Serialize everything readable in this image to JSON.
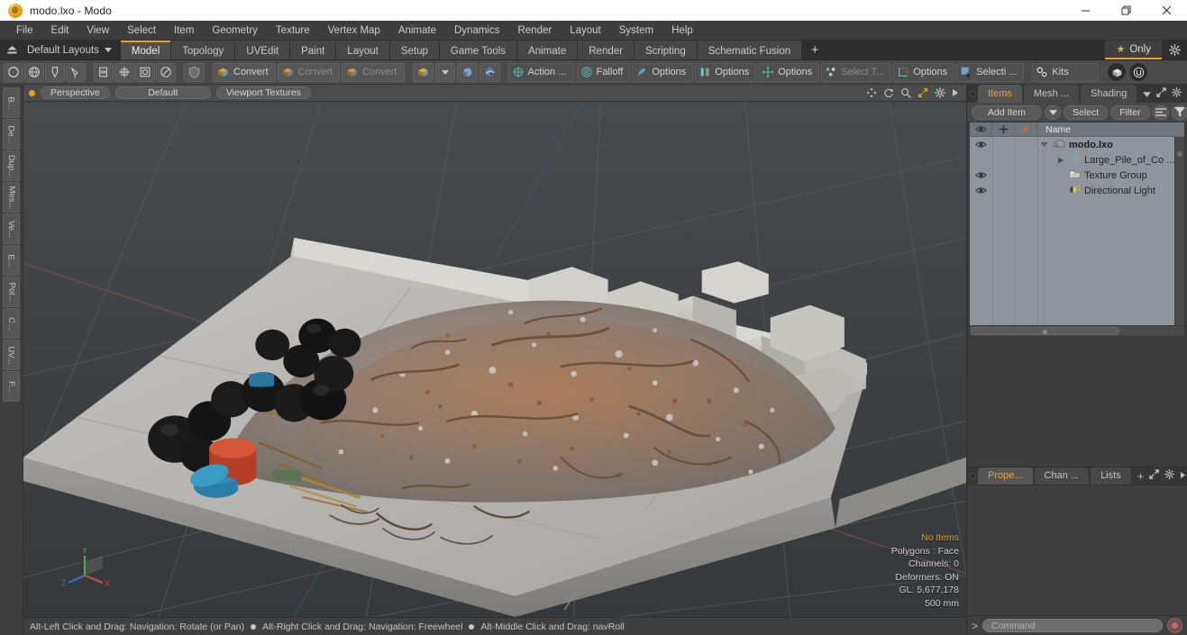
{
  "window": {
    "title": "modo.lxo - Modo",
    "app_icon": "modo-logo-icon",
    "controls": {
      "minimize": "minimize-icon",
      "maximize": "restore-icon",
      "close": "close-icon"
    }
  },
  "menubar": {
    "items": [
      "File",
      "Edit",
      "View",
      "Select",
      "Item",
      "Geometry",
      "Texture",
      "Vertex Map",
      "Animate",
      "Dynamics",
      "Render",
      "Layout",
      "System",
      "Help"
    ]
  },
  "layoutbar": {
    "home_icon": "home-eject-icon",
    "layouts_label": "Default Layouts",
    "tabs": [
      {
        "label": "Model",
        "active": true
      },
      {
        "label": "Topology",
        "active": false
      },
      {
        "label": "UVEdit",
        "active": false
      },
      {
        "label": "Paint",
        "active": false
      },
      {
        "label": "Layout",
        "active": false
      },
      {
        "label": "Setup",
        "active": false
      },
      {
        "label": "Game Tools",
        "active": false
      },
      {
        "label": "Animate",
        "active": false
      },
      {
        "label": "Render",
        "active": false
      },
      {
        "label": "Scripting",
        "active": false
      },
      {
        "label": "Schematic Fusion",
        "active": false
      }
    ],
    "add_tab_label": "+",
    "only_label": "Only",
    "only_star_icon": "star-icon",
    "gear_icon": "gear-icon",
    "accent_color": "#e0a32e"
  },
  "toolbar": {
    "groups": [
      {
        "items": [
          {
            "icon": "circle-icon",
            "label": ""
          },
          {
            "icon": "globe-icon",
            "label": ""
          },
          {
            "icon": "pen-icon",
            "label": ""
          },
          {
            "icon": "brush-icon",
            "label": ""
          }
        ]
      },
      {
        "items": [
          {
            "icon": "stack-icon",
            "label": ""
          },
          {
            "icon": "cube-axis-icon",
            "label": ""
          },
          {
            "icon": "square-circle-icon",
            "label": ""
          },
          {
            "icon": "circle-slash-icon",
            "label": ""
          }
        ]
      },
      {
        "items": [
          {
            "icon": "shield-icon",
            "label": ""
          }
        ]
      },
      {
        "items": [
          {
            "icon": "convert-box-icon",
            "label": "Convert"
          },
          {
            "icon": "convert-box-icon",
            "label": "Convert"
          },
          {
            "icon": "convert-box-icon",
            "label": "Convert"
          }
        ]
      },
      {
        "items": [
          {
            "icon": "yellow-cube-icon",
            "label": ""
          },
          {
            "icon": "chevron-down-icon",
            "label": ""
          },
          {
            "icon": "blue-sphere-icon",
            "label": ""
          },
          {
            "icon": "blue-sphere-alt-icon",
            "label": ""
          }
        ]
      },
      {
        "items": [
          {
            "icon": "action-center-icon",
            "label": "Action  ..."
          },
          {
            "icon": "falloff-icon",
            "label": "Falloff"
          },
          {
            "icon": "snapping-icon",
            "label": "Options"
          },
          {
            "icon": "symmetry-icon",
            "label": "Options"
          },
          {
            "icon": "workplane-icon",
            "label": "Options"
          },
          {
            "icon": "select-through-icon",
            "label": "Select T..."
          },
          {
            "icon": "element-move-icon",
            "label": "Options"
          },
          {
            "icon": "selection-set-icon",
            "label": "Selecti ..."
          }
        ]
      },
      {
        "items": [
          {
            "icon": "kits-gear-icon",
            "label": "Kits"
          }
        ]
      },
      {
        "items": [
          {
            "icon": "modo-round-icon",
            "label": ""
          },
          {
            "icon": "unreal-icon",
            "label": ""
          }
        ]
      }
    ]
  },
  "left_tabs": {
    "items": [
      "B...",
      "De...",
      "Dup...",
      "Mes...",
      "Ve...",
      "E...",
      "Pol...",
      "C...",
      "UV...",
      "F..."
    ]
  },
  "viewport": {
    "header": {
      "indicator_icon": "active-dot-icon",
      "buttons": [
        "Perspective",
        "Default",
        "Viewport Textures"
      ],
      "tools": [
        "move-icon",
        "rotate-icon",
        "magnify-icon",
        "fullscreen-icon",
        "gear-icon",
        "play-arrow-icon"
      ]
    },
    "gizmo": {
      "x_label": "X",
      "y_label": "Y",
      "z_label": "Z",
      "x_color": "#d04848",
      "y_color": "#3fb34f",
      "z_color": "#3a6fd0"
    },
    "stats": [
      {
        "text": "No Items",
        "highlight": true
      },
      {
        "text": "Polygons : Face",
        "highlight": false
      },
      {
        "text": "Channels: 0",
        "highlight": false
      },
      {
        "text": "Deformers: ON",
        "highlight": false
      },
      {
        "text": "GL: 5,677,178",
        "highlight": false
      },
      {
        "text": "500 mm",
        "highlight": false
      }
    ]
  },
  "statusbar": {
    "hints": [
      "Alt-Left Click and Drag: Navigation: Rotate (or Pan)",
      "Alt-Right Click and Drag: Navigation: Freewheel",
      "Alt-Middle Click and Drag: navRoll"
    ]
  },
  "right_panel": {
    "top_tabs": [
      {
        "label": "Items",
        "active": true
      },
      {
        "label": "Mesh ...",
        "active": false
      },
      {
        "label": "Shading",
        "active": false
      }
    ],
    "top_tabs_right_icons": [
      "chevron-down-icon",
      "expand-icon",
      "gear-icon",
      "play-arrow-icon"
    ],
    "toolrow": {
      "add_item_label": "Add Item",
      "add_item_caret": "chevron-down-icon",
      "select_label": "Select",
      "filter_label": "Filter",
      "align_icon": "align-left-icon",
      "funnel_icon": "funnel-icon"
    },
    "item_list": {
      "columns": [
        "eye-icon",
        "lock-plus-icon",
        "render-icon",
        "Name"
      ],
      "name_header": "Name",
      "rows": [
        {
          "name": "modo.lxo",
          "icon": "scene-icon",
          "depth": 0,
          "bold": true,
          "twisty": "down",
          "eye": true
        },
        {
          "name": "Large_Pile_of_Co ...",
          "icon": "mesh-icon",
          "depth": 1,
          "bold": false,
          "twisty": "right",
          "eye": false
        },
        {
          "name": "Texture Group",
          "icon": "texture-group-icon",
          "depth": 1,
          "bold": false,
          "twisty": "none",
          "eye": true
        },
        {
          "name": "Directional Light",
          "icon": "light-icon",
          "depth": 1,
          "bold": false,
          "twisty": "none",
          "eye": true
        }
      ]
    },
    "props_tabs": [
      {
        "label": "Prope...",
        "active": true
      },
      {
        "label": "Chan ...",
        "active": false
      },
      {
        "label": "Lists",
        "active": false
      }
    ],
    "props_tabs_right_icons": [
      "plus-icon",
      "expand-icon",
      "gear-icon",
      "play-arrow-icon"
    ]
  },
  "command_bar": {
    "prompt": ">",
    "placeholder": "Command",
    "value": "",
    "record_icon": "record-icon"
  },
  "colors": {
    "accent": "#e0a32e",
    "panel_bg": "#3c3c3c",
    "toolbar_bg": "#4a4a4a",
    "list_bg": "#8e959c",
    "viewport_bg": "#3f4245"
  }
}
